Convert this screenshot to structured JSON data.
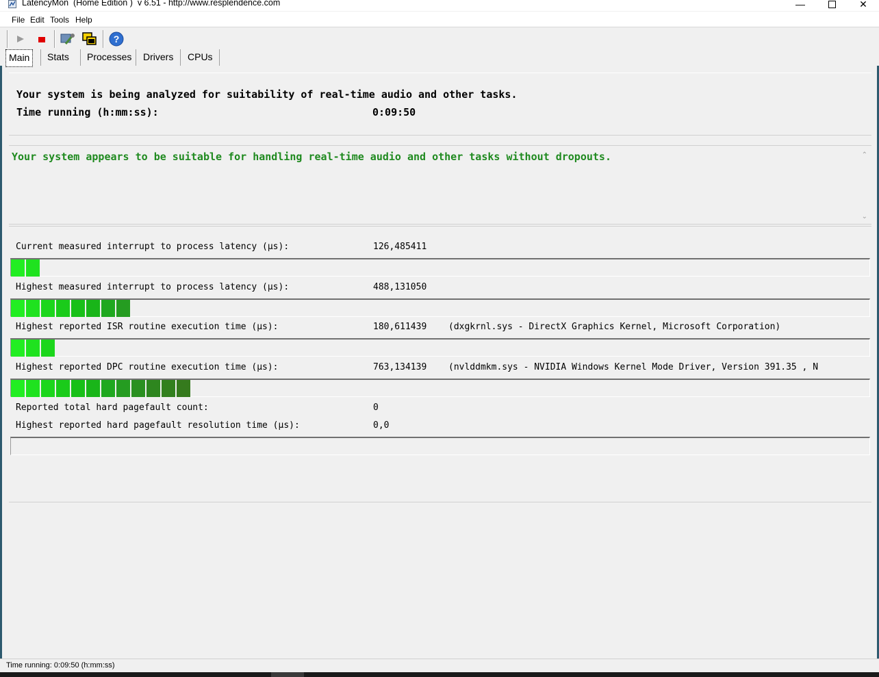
{
  "window": {
    "title": "LatencyMon  (Home Edition )  v 6.51 - http://www.resplendence.com",
    "controls": {
      "minimize": "—",
      "close": "✕"
    }
  },
  "menu": [
    "File",
    "Edit",
    "Tools",
    "Help"
  ],
  "toolbar": {
    "icons": [
      "play-icon",
      "stop-icon",
      "wrench-icon",
      "windows-icon",
      "help-icon"
    ],
    "help_glyph": "?"
  },
  "tabs": [
    "Main",
    "Stats",
    "Processes",
    "Drivers",
    "CPUs"
  ],
  "status": {
    "line1": "Your system is being analyzed for suitability of real-time audio and other tasks.",
    "time_label": "Time running (h:mm:ss):",
    "time_value": "0:09:50"
  },
  "verdict": {
    "text": "Your system appears to be suitable for handling real-time audio and other tasks without dropouts.",
    "color": "#1f8a1f"
  },
  "metrics": {
    "current_latency": {
      "label": "Current measured interrupt to process latency (µs):",
      "value": "126,485411",
      "segments": 2
    },
    "highest_latency": {
      "label": "Highest measured interrupt to process latency (µs):",
      "value": "488,131050",
      "segments": 8
    },
    "isr": {
      "label": "Highest reported ISR routine execution time (µs):",
      "value": "180,611439",
      "extra": "(dxgkrnl.sys - DirectX Graphics Kernel, Microsoft Corporation)",
      "segments": 3
    },
    "dpc": {
      "label": "Highest reported DPC routine execution time (µs):",
      "value": "763,134139",
      "extra": "(nvlddmkm.sys - NVIDIA Windows Kernel Mode Driver, Version 391.35 , N",
      "segments": 12
    },
    "pagefault_count": {
      "label": "Reported total hard pagefault count:",
      "value": "0"
    },
    "pagefault_time": {
      "label": "Highest reported hard pagefault resolution time (µs):",
      "value": "0,0",
      "segments": 0
    }
  },
  "statusbar": {
    "text": "Time running: 0:09:50  (h:mm:ss)"
  }
}
